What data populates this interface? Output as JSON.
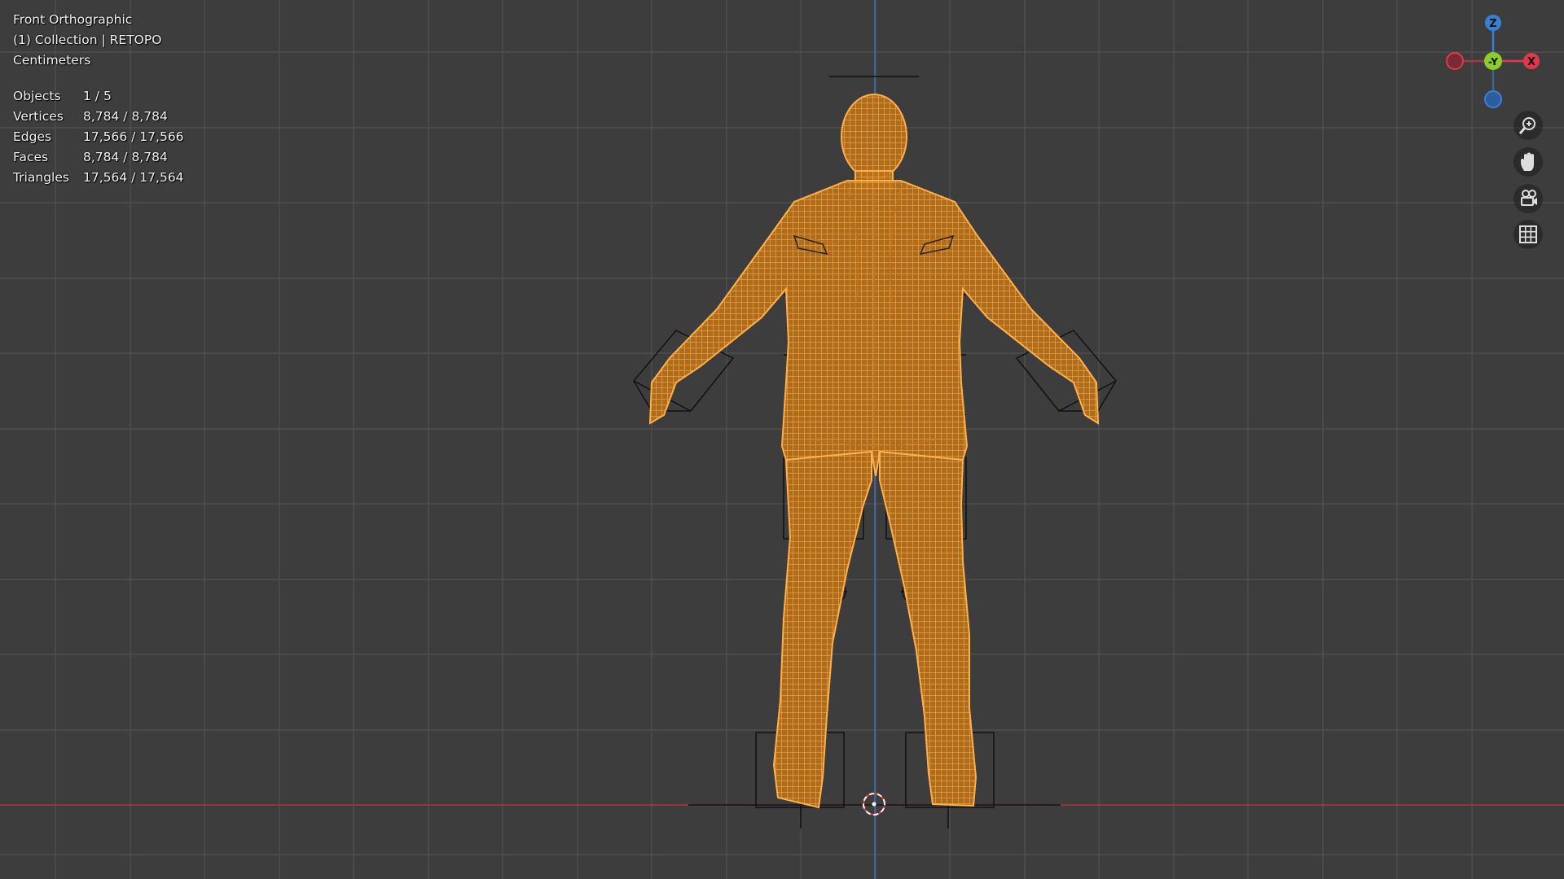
{
  "viewport": {
    "view_name": "Front Orthographic",
    "collection": "(1) Collection | RETOPO",
    "units": "Centimeters"
  },
  "stats": [
    {
      "label": "Objects",
      "value": "1 / 5"
    },
    {
      "label": "Vertices",
      "value": "8,784 / 8,784"
    },
    {
      "label": "Edges",
      "value": "17,566 / 17,566"
    },
    {
      "label": "Faces",
      "value": "8,784 / 8,784"
    },
    {
      "label": "Triangles",
      "value": "17,564 / 17,564"
    }
  ],
  "gizmo": {
    "z_label": "Z",
    "y_label": "-Y",
    "x_label": "X",
    "colors": {
      "x": "#e0394a",
      "y": "#8ccd2a",
      "z": "#3a7fd6"
    }
  },
  "nav_buttons": [
    {
      "icon": "zoom-icon"
    },
    {
      "icon": "hand-pan-icon"
    },
    {
      "icon": "camera-view-icon"
    },
    {
      "icon": "grid-ortho-icon"
    }
  ],
  "colors": {
    "background": "#3d3d3d",
    "grid": "#4c4c4c",
    "grid_major": "#545454",
    "mesh": "#f29a2e",
    "x_axis": "#a83a3a",
    "z_axis": "#3a6db5"
  }
}
